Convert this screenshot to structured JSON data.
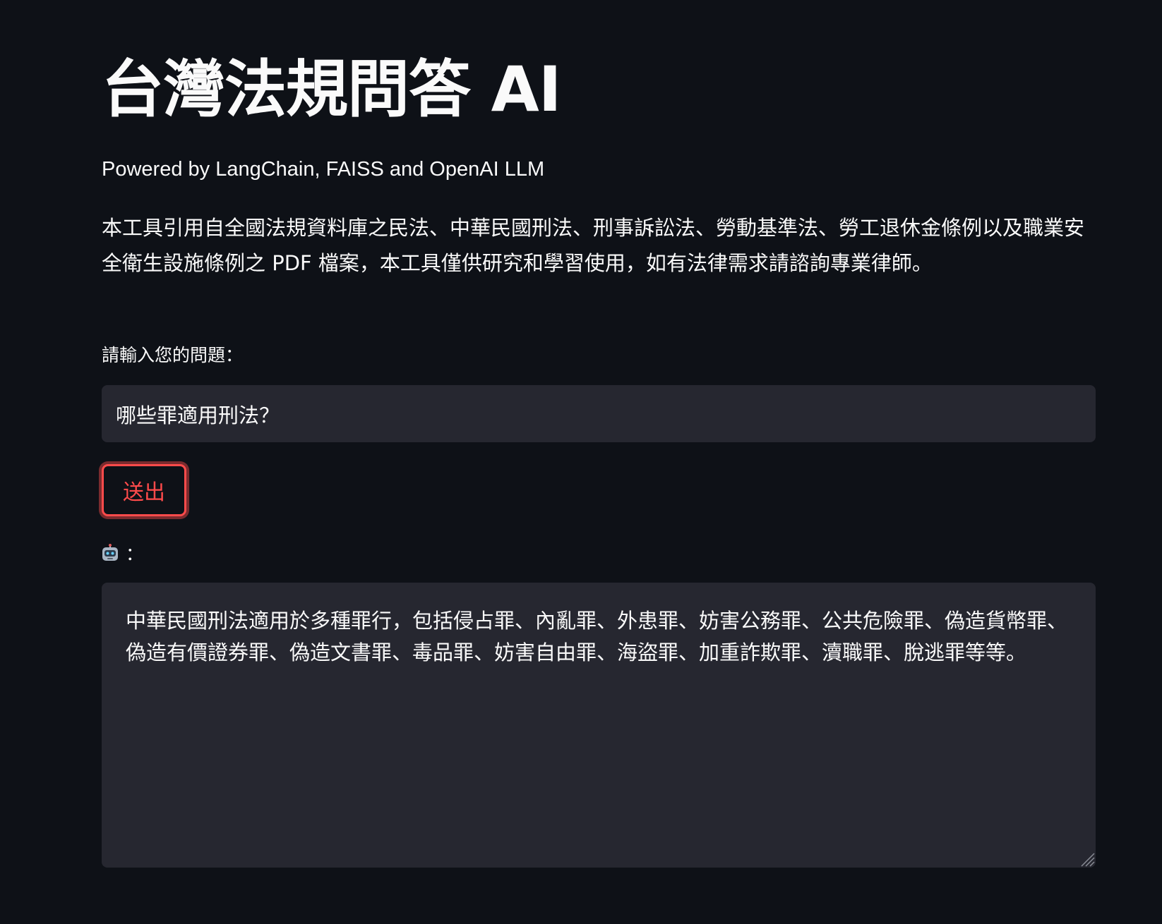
{
  "header": {
    "title": "台灣法規問答 AI",
    "subtitle": "Powered by LangChain, FAISS and OpenAI LLM"
  },
  "description": "本工具引用自全國法規資料庫之民法、中華民國刑法、刑事訴訟法、勞動基準法、勞工退休金條例以及職業安全衛生設施條例之 PDF 檔案，本工具僅供研究和學習使用，如有法律需求請諮詢專業律師。",
  "question": {
    "label": "請輸入您的問題：",
    "value": "哪些罪適用刑法？"
  },
  "submit": {
    "label": "送出"
  },
  "answer": {
    "label": "：",
    "icon": "robot-icon",
    "text": "中華民國刑法適用於多種罪行，包括侵占罪、內亂罪、外患罪、妨害公務罪、公共危險罪、偽造貨幣罪、偽造有價證券罪、偽造文書罪、毒品罪、妨害自由罪、海盜罪、加重詐欺罪、瀆職罪、脫逃罪等等。"
  },
  "colors": {
    "background": "#0e1117",
    "input_background": "#262730",
    "accent": "#ff4b4b",
    "text": "#fafafa"
  }
}
